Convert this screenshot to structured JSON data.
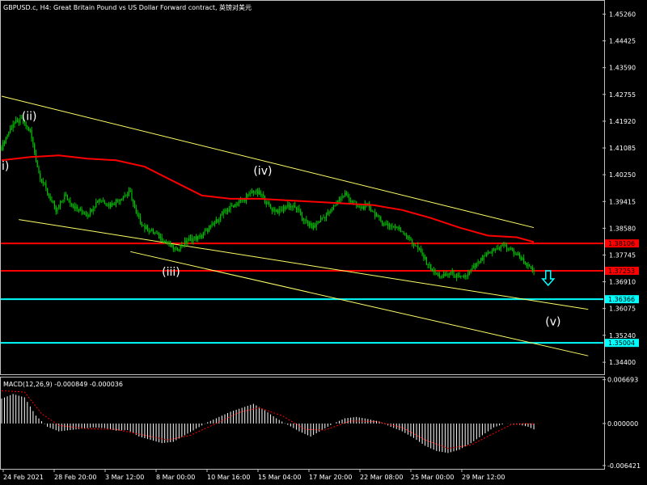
{
  "window": {
    "title": "GBPUSD.c, H4:  Great Britain Pound vs US Dollar Forward contract, 英镑对美元"
  },
  "colors": {
    "background": "#000000",
    "frame": "#c0c0c0",
    "candle": "#00c000",
    "ma": "#ff0000",
    "channel": "#ffff66",
    "support": "#00ffff",
    "resistance": "#ff0000",
    "macd_hist": "#ffffff",
    "macd_signal": "#ff0000"
  },
  "chart_data": [
    {
      "type": "candlestick",
      "symbol": "GBPUSD.c",
      "timeframe": "H4",
      "ylim": [
        1.3405,
        1.4565
      ],
      "y_ticks": [
        "1.45260",
        "1.44425",
        "1.43590",
        "1.42755",
        "1.41920",
        "1.41085",
        "1.40250",
        "1.39415",
        "1.38580",
        "1.37745",
        "1.36910",
        "1.36075",
        "1.35240",
        "1.34400"
      ],
      "x_ticks": [
        "24 Feb 2021",
        "28 Feb 20:00",
        "3 Mar 12:00",
        "8 Mar 00:00",
        "10 Mar 16:00",
        "15 Mar 04:00",
        "17 Mar 20:00",
        "22 Mar 08:00",
        "25 Mar 00:00",
        "29 Mar 12:00"
      ],
      "close_path": [
        [
          0,
          1.411
        ],
        [
          4,
          1.415
        ],
        [
          8,
          1.4185
        ],
        [
          14,
          1.4195
        ],
        [
          20,
          1.416
        ],
        [
          26,
          1.403
        ],
        [
          32,
          1.397
        ],
        [
          38,
          1.391
        ],
        [
          44,
          1.396
        ],
        [
          52,
          1.392
        ],
        [
          60,
          1.39
        ],
        [
          68,
          1.395
        ],
        [
          76,
          1.393
        ],
        [
          84,
          1.3955
        ],
        [
          90,
          1.397
        ],
        [
          94,
          1.39
        ],
        [
          100,
          1.386
        ],
        [
          108,
          1.384
        ],
        [
          116,
          1.381
        ],
        [
          122,
          1.379
        ],
        [
          130,
          1.382
        ],
        [
          138,
          1.383
        ],
        [
          146,
          1.386
        ],
        [
          154,
          1.39
        ],
        [
          162,
          1.393
        ],
        [
          170,
          1.395
        ],
        [
          176,
          1.3975
        ],
        [
          182,
          1.396
        ],
        [
          188,
          1.392
        ],
        [
          194,
          1.391
        ],
        [
          200,
          1.393
        ],
        [
          206,
          1.392
        ],
        [
          212,
          1.388
        ],
        [
          218,
          1.386
        ],
        [
          224,
          1.389
        ],
        [
          230,
          1.391
        ],
        [
          236,
          1.395
        ],
        [
          240,
          1.3965
        ],
        [
          244,
          1.3945
        ],
        [
          250,
          1.392
        ],
        [
          256,
          1.393
        ],
        [
          262,
          1.3895
        ],
        [
          268,
          1.387
        ],
        [
          274,
          1.3865
        ],
        [
          280,
          1.385
        ],
        [
          284,
          1.383
        ],
        [
          290,
          1.38
        ],
        [
          296,
          1.376
        ],
        [
          302,
          1.372
        ],
        [
          308,
          1.3705
        ],
        [
          314,
          1.372
        ],
        [
          320,
          1.37
        ],
        [
          326,
          1.3715
        ],
        [
          332,
          1.3745
        ],
        [
          338,
          1.377
        ],
        [
          344,
          1.379
        ],
        [
          350,
          1.3805
        ],
        [
          356,
          1.379
        ],
        [
          362,
          1.377
        ],
        [
          368,
          1.374
        ],
        [
          372,
          1.372
        ]
      ],
      "moving_average": [
        [
          0,
          1.407
        ],
        [
          20,
          1.408
        ],
        [
          40,
          1.4085
        ],
        [
          60,
          1.4075
        ],
        [
          80,
          1.407
        ],
        [
          100,
          1.405
        ],
        [
          120,
          1.4005
        ],
        [
          140,
          1.396
        ],
        [
          160,
          1.395
        ],
        [
          180,
          1.395
        ],
        [
          200,
          1.3945
        ],
        [
          220,
          1.394
        ],
        [
          240,
          1.3935
        ],
        [
          260,
          1.393
        ],
        [
          280,
          1.3915
        ],
        [
          300,
          1.389
        ],
        [
          320,
          1.386
        ],
        [
          340,
          1.3835
        ],
        [
          360,
          1.383
        ],
        [
          372,
          1.3815
        ]
      ],
      "channel_lines": [
        {
          "from": [
            0,
            1.427
          ],
          "to": [
            372,
            1.386
          ]
        },
        {
          "from": [
            12,
            1.3885
          ],
          "to": [
            410,
            1.3605
          ]
        },
        {
          "from": [
            90,
            1.3785
          ],
          "to": [
            410,
            1.346
          ]
        }
      ],
      "levels": [
        {
          "label": "1.38106",
          "price": 1.38106,
          "kind": "resistance"
        },
        {
          "label": "1.37253",
          "price": 1.37253,
          "kind": "resistance"
        },
        {
          "label": "1.36366",
          "price": 1.36366,
          "kind": "support"
        },
        {
          "label": "1.35004",
          "price": 1.35004,
          "kind": "support"
        }
      ],
      "wave_labels": [
        {
          "text": "i)",
          "bar": 0,
          "price": 1.404
        },
        {
          "text": "(ii)",
          "bar": 14,
          "price": 1.4195
        },
        {
          "text": "(iii)",
          "bar": 112,
          "price": 1.371
        },
        {
          "text": "(iv)",
          "bar": 176,
          "price": 1.4025
        },
        {
          "text": "(v)",
          "bar": 380,
          "price": 1.3555
        }
      ],
      "arrow": {
        "direction": "down",
        "bar": 382,
        "price": 1.37
      }
    },
    {
      "type": "macd",
      "label": "MACD(12,26,9) -0.000849 -0.000036",
      "ylim": [
        -0.0068,
        0.0069
      ],
      "y_ticks": [
        "0.006693",
        "0.000000",
        "-0.006421"
      ],
      "histogram": [
        [
          0,
          0.0038
        ],
        [
          8,
          0.0045
        ],
        [
          16,
          0.004
        ],
        [
          24,
          0.0012
        ],
        [
          32,
          -0.0005
        ],
        [
          40,
          -0.0012
        ],
        [
          48,
          -0.001
        ],
        [
          56,
          -0.0008
        ],
        [
          64,
          -0.0006
        ],
        [
          72,
          -0.0007
        ],
        [
          80,
          -0.0011
        ],
        [
          88,
          -0.001
        ],
        [
          96,
          -0.002
        ],
        [
          104,
          -0.0025
        ],
        [
          112,
          -0.003
        ],
        [
          120,
          -0.0028
        ],
        [
          128,
          -0.0018
        ],
        [
          136,
          -0.0008
        ],
        [
          144,
          0.0002
        ],
        [
          152,
          0.001
        ],
        [
          160,
          0.0018
        ],
        [
          168,
          0.0024
        ],
        [
          176,
          0.003
        ],
        [
          184,
          0.002
        ],
        [
          192,
          0.0008
        ],
        [
          200,
          -0.0002
        ],
        [
          208,
          -0.0012
        ],
        [
          216,
          -0.002
        ],
        [
          224,
          -0.001
        ],
        [
          232,
          0.0
        ],
        [
          240,
          0.0008
        ],
        [
          248,
          0.001
        ],
        [
          256,
          0.0007
        ],
        [
          264,
          0.0003
        ],
        [
          272,
          -0.0005
        ],
        [
          280,
          -0.0012
        ],
        [
          288,
          -0.0022
        ],
        [
          296,
          -0.0034
        ],
        [
          304,
          -0.0042
        ],
        [
          312,
          -0.0045
        ],
        [
          320,
          -0.004
        ],
        [
          328,
          -0.003
        ],
        [
          336,
          -0.0018
        ],
        [
          344,
          -0.0006
        ],
        [
          352,
          0.0
        ],
        [
          360,
          -0.0001
        ],
        [
          368,
          -0.0005
        ],
        [
          372,
          -0.0009
        ]
      ],
      "signal": [
        [
          0,
          0.005
        ],
        [
          16,
          0.0048
        ],
        [
          28,
          0.0015
        ],
        [
          40,
          -0.0003
        ],
        [
          60,
          -0.0008
        ],
        [
          80,
          -0.0009
        ],
        [
          100,
          -0.0018
        ],
        [
          116,
          -0.0025
        ],
        [
          132,
          -0.0018
        ],
        [
          150,
          0.0
        ],
        [
          166,
          0.0017
        ],
        [
          180,
          0.0024
        ],
        [
          196,
          0.0012
        ],
        [
          212,
          -0.0009
        ],
        [
          226,
          -0.001
        ],
        [
          244,
          0.0004
        ],
        [
          262,
          0.0003
        ],
        [
          280,
          -0.0006
        ],
        [
          296,
          -0.0025
        ],
        [
          312,
          -0.0038
        ],
        [
          328,
          -0.0033
        ],
        [
          344,
          -0.0015
        ],
        [
          356,
          -0.0002
        ],
        [
          366,
          0.0
        ],
        [
          372,
          -0.0001
        ]
      ]
    }
  ]
}
